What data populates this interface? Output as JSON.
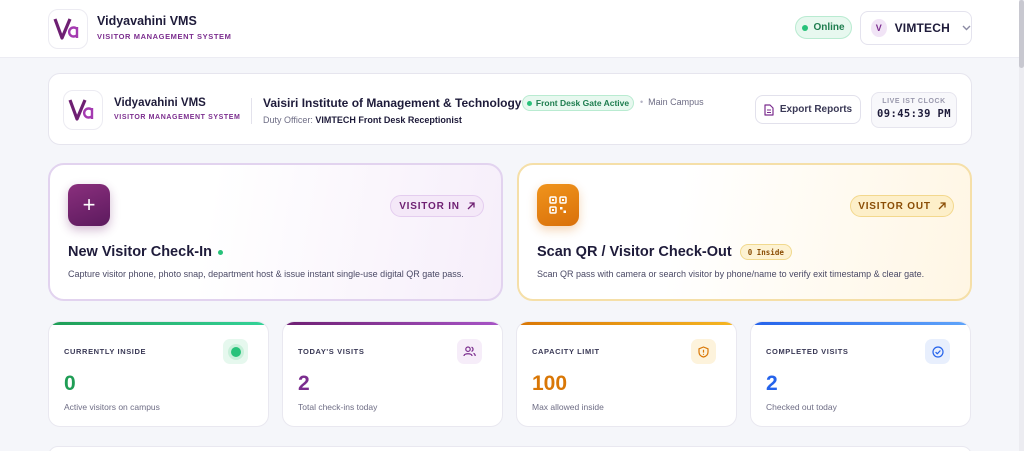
{
  "header": {
    "brand_name": "Vidyavahini VMS",
    "brand_sub": "VISITOR MANAGEMENT SYSTEM",
    "logo_icon": "vidyavahini-logo",
    "status": "Online",
    "user_initial": "V",
    "user_name": "VIMTECH",
    "user_menu_icon": "chevron-down-icon"
  },
  "info_bar": {
    "brand_name": "Vidyavahini VMS",
    "brand_sub": "VISITOR MANAGEMENT SYSTEM",
    "institution": "Vaisiri Institute of Management & Technology",
    "gate_status": "Front Desk Gate Active",
    "campus": "Main Campus",
    "duty_label": "Duty Officer:",
    "duty_officer": "VIMTECH Front Desk Receptionist",
    "export_label": "Export Reports",
    "clock_label": "LIVE IST CLOCK",
    "clock_time": "09:45:39 PM"
  },
  "actions": {
    "checkin": {
      "tag": "VISITOR IN",
      "title": "New Visitor Check-In",
      "description": "Capture visitor phone, photo snap, department host & issue instant single-use digital QR gate pass."
    },
    "checkout": {
      "tag": "VISITOR OUT",
      "title": "Scan QR / Visitor Check-Out",
      "badge": "0 Inside",
      "description": "Scan QR pass with camera or search visitor by phone/name to verify exit timestamp & clear gate."
    }
  },
  "stats": [
    {
      "label": "CURRENTLY INSIDE",
      "value": "0",
      "sub": "Active visitors on campus",
      "icon": "live-dot-icon",
      "color": "#1f9d55"
    },
    {
      "label": "TODAY'S VISITS",
      "value": "2",
      "sub": "Total check-ins today",
      "icon": "users-icon",
      "color": "#7b2d8e"
    },
    {
      "label": "CAPACITY LIMIT",
      "value": "100",
      "sub": "Max allowed inside",
      "icon": "shield-alert-icon",
      "color": "#d97706"
    },
    {
      "label": "COMPLETED VISITS",
      "value": "2",
      "sub": "Checked out today",
      "icon": "check-circle-icon",
      "color": "#2563eb"
    }
  ],
  "colors": {
    "brand": "#7b2d8e",
    "success": "#27c27a",
    "warning": "#d97706",
    "info": "#2563eb"
  }
}
